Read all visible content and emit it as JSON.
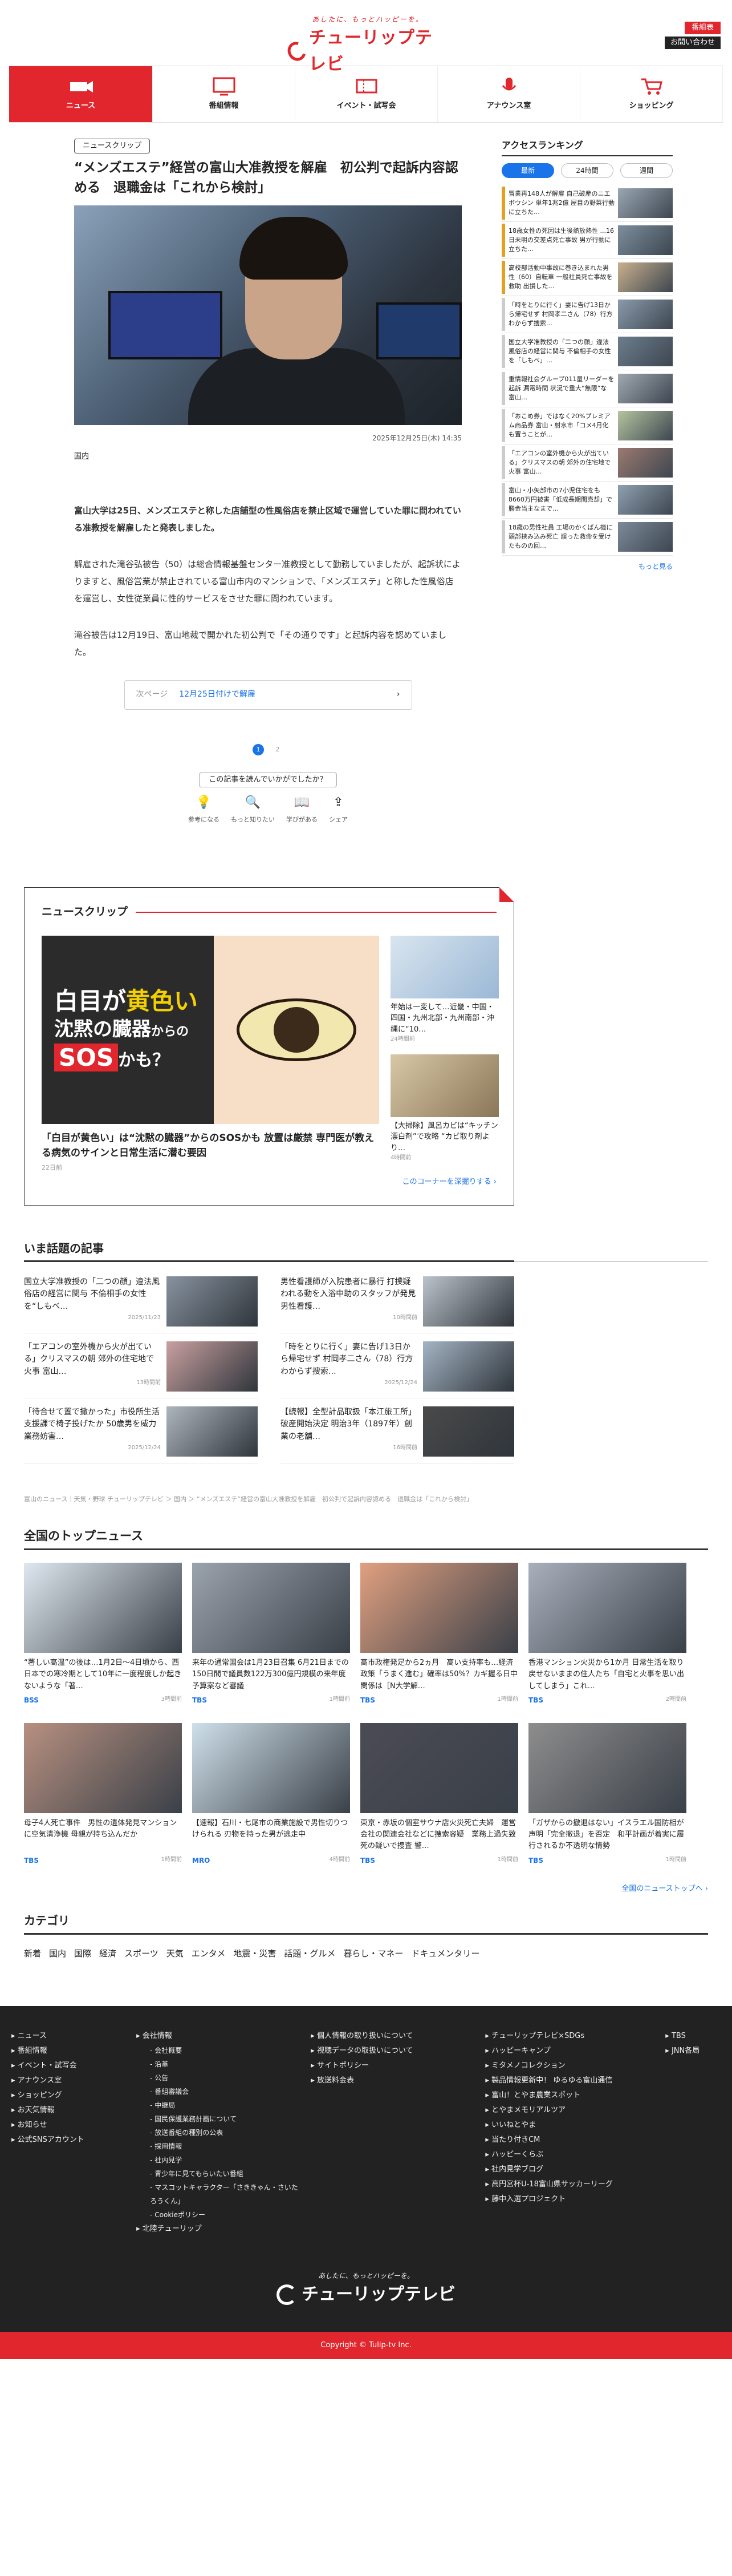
{
  "header": {
    "tagline": "あしたに、もっとハッピーを。",
    "brand": "チューリップテレビ",
    "btn_latest": "番組表",
    "btn_contact": "お問い合わせ"
  },
  "nav": [
    {
      "label": "ニュース",
      "icon": "news-icon"
    },
    {
      "label": "番組情報",
      "icon": "tv-icon"
    },
    {
      "label": "イベント・試写会",
      "icon": "ticket-icon"
    },
    {
      "label": "アナウンス室",
      "icon": "microphone-icon"
    },
    {
      "label": "ショッピング",
      "icon": "cart-icon"
    }
  ],
  "article": {
    "badge": "ニュースクリップ",
    "title": "“メンズエステ”経営の富山大准教授を解雇　初公判で起訴内容認める　退職金は「これから検討」",
    "date": "2025年12月25日(木) 14:35",
    "category": "国内",
    "paragraphs": [
      "富山大学は25日、メンズエステと称した店舗型の性風俗店を禁止区域で運営していた罪に問われている准教授を解雇したと発表しました。",
      "解雇された滝谷弘被告（50）は総合情報基盤センター准教授として勤務していましたが、起訴状によりますと、風俗営業が禁止されている富山市内のマンションで、「メンズエステ」と称した性風俗店を運営し、女性従業員に性的サービスをさせた罪に問われています。",
      "滝谷被告は12月19日、富山地裁で開かれた初公判で「その通りです」と起訴内容を認めていました。"
    ],
    "next_label": "次ページ",
    "next_title": "12月25日付けで解雇",
    "pages": [
      "1",
      "2"
    ],
    "reaction_q": "この記事を読んでいかがでしたか？",
    "reactions": [
      {
        "label": "参考になる",
        "icon": "bulb-icon",
        "glyph": "💡"
      },
      {
        "label": "もっと知りたい",
        "icon": "search-icon",
        "glyph": "🔍"
      },
      {
        "label": "学びがある",
        "icon": "book-icon",
        "glyph": "📖"
      },
      {
        "label": "シェア",
        "icon": "share-icon",
        "glyph": "⇪"
      }
    ]
  },
  "ranking": {
    "title": "アクセスランキング",
    "tabs": [
      "最新",
      "24時間",
      "週間"
    ],
    "items": [
      "冒業再148人が解雇 自己破産のニエボウシン 単年1兆2億 屋目の野菜行動に立ちた…",
      "18歳女性の死因は生後熱放熱性 ...16日未明の交差点死亡事故 男が行動に立ちた…",
      "高校部活動中事故に巻き込まれた男性（60）自転車 一般社員死亡事故を救助 出損した…",
      "「時をとりに行く」妻に告げ13日から帰宅せず 村岡孝二さん（78）行方わからず捜索…",
      "国立大学准教授の「二つの顔」違法風俗店の経営に関与 不倫相手の女性を「しもべ」…",
      "重情報社会グループ011量リーダーを起訴 漏電時間 状況で重大”無限”な 富山…",
      "「おこめ券」ではなく20%プレミアム商品券 富山・射水市「コメ4月化も置うことが…",
      "「エアコンの室外機から火が出ている」クリスマスの朝 郊外の住宅地で火事 富山…",
      "富山・小矢部市の7小児住宅をも8660万円被害「低成長期間売却」で勝金当主なまで…",
      "18歳の男性社員 工場のかくばん機に頭部挟み込み死亡 誤った救命を受けたものの回…"
    ],
    "more": "もっと見る"
  },
  "clip": {
    "title": "ニュースクリップ",
    "main_img_text": [
      "白目が",
      "黄色い",
      "沈黙の臓器",
      "からの",
      "SOS",
      "かも？"
    ],
    "main_caption": "「白目が黄色い」は“沈黙の臓器”からのSOSかも 放置は厳禁 専門医が教える病気のサインと日常生活に潜む要因",
    "main_date": "22日前",
    "subs": [
      {
        "title": "年始は一変して…近畿・中国・四国・九州北部・九州南部・沖縄に“10…",
        "date": "24時間前"
      },
      {
        "title": "【大掃除】風呂カビは“キッチン漂白剤”で攻略 “カビ取り剤より…",
        "date": "4時間前"
      }
    ],
    "deep": "このコーナーを深掘りする ›"
  },
  "trending": {
    "title": "いま話題の記事",
    "items": [
      {
        "title": "国立大学准教授の「二つの顔」違法風俗店の経営に関与 不倫相手の女性を“しもべ…",
        "date": "2025/11/23"
      },
      {
        "title": "男性看護師が入院患者に暴行 打撲疑われる動を入浴中助のスタッフが発見 男性看護…",
        "date": "10時間前"
      },
      {
        "title": "「エアコンの室外機から火が出ている」クリスマスの朝 郊外の住宅地で火事 富山…",
        "date": "13時間前"
      },
      {
        "title": "「時をとりに行く」妻に告げ13日から帰宅せず 村岡孝二さん（78）行方わからず捜索…",
        "date": "2025/12/24"
      },
      {
        "title": "「待合せて置で撒かった」市役所生活支援課で椅子投げたか 50歳男を威力業務妨害…",
        "date": "2025/12/24"
      },
      {
        "title": "【続報】全型計品取扱「本江旅工所」破産開始決定 明治3年（1897年）創業の老舗…",
        "date": "16時間前"
      }
    ]
  },
  "breadcrumb": "富山のニュース｜天気・野球 チューリップテレビ ＞ 国内 ＞ “メンズエステ”経営の富山大准教授を解雇　初公判で起訴内容認める　退職金は「これから検討」",
  "top": {
    "title": "全国のトップニュース",
    "items": [
      {
        "title": "“著しい高温”の後は…1月2日〜4日頃から、西日本での寒冷期として10年に一度程度しか起きないような「著…",
        "src": "BSS",
        "date": "3時間前"
      },
      {
        "title": "来年の通常国会は1月23日召集 6月21日までの150日間で議員数122万300億円規模の来年度予算案など審議",
        "src": "TBS",
        "date": "1時間前"
      },
      {
        "title": "高市政権発足から2ヵ月　高い支持率も…経済政策「うまく進む」確率は50%？カギ握る日中関係は［N大学解…",
        "src": "TBS",
        "date": "1時間前"
      },
      {
        "title": "香港マンション火災から1か月 日常生活を取り戻せないままの住人たち「自宅と火事を思い出してしまう」これ…",
        "src": "TBS",
        "date": "2時間前"
      },
      {
        "title": "母子4人死亡事件　男性の遺体発見マンションに空気清浄機 母親が持ち込んだか",
        "src": "TBS",
        "date": "1時間前"
      },
      {
        "title": "【速報】石川・七尾市の商業施設で男性切りつけられる 刃物を持った男が逃走中",
        "src": "MRO",
        "date": "4時間前"
      },
      {
        "title": "東京・赤坂の個室サウナ店火災死亡夫婦　運営会社の関連会社などに捜索容疑　業務上過失致死の疑いで捜査 警…",
        "src": "TBS",
        "date": "1時間前"
      },
      {
        "title": "「ガザからの撤退はない」イスラエル国防相が声明「完全撤退」を否定　和平計画が着実に履行されるか不透明な情勢",
        "src": "TBS",
        "date": "1時間前"
      }
    ],
    "more": "全国のニューストップへ ›"
  },
  "categories": {
    "title": "カテゴリ",
    "items": [
      "新着",
      "国内",
      "国際",
      "経済",
      "スポーツ",
      "天気",
      "エンタメ",
      "地震・災害",
      "話題・グルメ",
      "暮らし・マネー",
      "ドキュメンタリー"
    ]
  },
  "footer": {
    "col1": [
      "ニュース",
      "番組情報",
      "イベント・試写会",
      "アナウンス室",
      "ショッピング",
      "お天気情報",
      "お知らせ",
      "公式SNSアカウント"
    ],
    "col2_head": "会社情報",
    "col2": [
      "会社概要",
      "沿革",
      "公告",
      "番組審議会",
      "中継局",
      "国民保護業務計画について",
      "放送番組の種別の公表",
      "採用情報",
      "社内見学",
      "青少年に見てもらいたい番組",
      "マスコットキャラクター「さききゃん・さいたろうくん」",
      "Cookieポリシー"
    ],
    "col2_tail": "北陸チューリップ",
    "col3": [
      "個人情報の取り扱いについて",
      "視聴データの取扱いについて",
      "サイトポリシー",
      "放送料金表"
    ],
    "col4": [
      "チューリップテレビ×SDGs",
      "ハッピーキャンプ",
      "ミタメノコレクション",
      "製品情報更新中！ ゆるゆる富山通信",
      "富山！とやま農業スポット",
      "とやまメモリアルツア",
      "いいねとやま",
      "当たり付きCM",
      "ハッピーくらぶ",
      "社内見学ブログ",
      "高円宮杯U-18富山県サッカーリーグ",
      "藤中入選プロジェクト"
    ],
    "col5": [
      "TBS",
      "JNN各局"
    ],
    "brand": "チューリップテレビ",
    "tagline": "あしたに、もっとハッピーを。",
    "copyright": "Copyright © Tulip-tv Inc."
  }
}
